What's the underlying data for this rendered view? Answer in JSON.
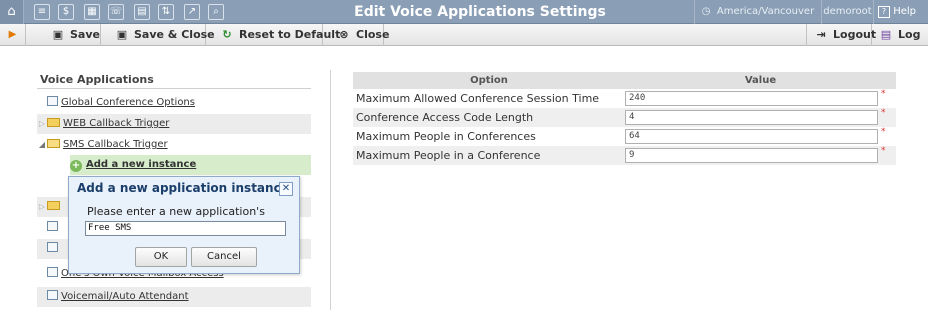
{
  "header": {
    "title": "Edit Voice Applications Settings",
    "timezone": "America/Vancouver",
    "user": "demoroot",
    "help_label": "Help"
  },
  "toolbar": {
    "save_label": "Save",
    "save_close_label": "Save & Close",
    "reset_label": "Reset to Default",
    "close_label": "Close",
    "logout_label": "Logout",
    "log_label": "Log"
  },
  "sidebar": {
    "title": "Voice Applications",
    "items": [
      {
        "label": "Global Conference Options",
        "icon": "document-icon"
      },
      {
        "label": "WEB Callback Trigger",
        "icon": "folder-icon"
      },
      {
        "label": "SMS Callback Trigger",
        "icon": "folder-icon"
      },
      {
        "label": "Add a new instance",
        "icon": "add-icon"
      },
      {
        "label": "One's Own Voice Mailbox Access",
        "icon": "document-icon"
      },
      {
        "label": "Voicemail/Auto Attendant",
        "icon": "document-icon"
      }
    ]
  },
  "table": {
    "col_option": "Option",
    "col_value": "Value",
    "rows": [
      {
        "option": "Maximum Allowed Conference Session Time",
        "value": "240"
      },
      {
        "option": "Conference Access Code Length",
        "value": "4"
      },
      {
        "option": "Maximum People in Conferences",
        "value": "64"
      },
      {
        "option": "Maximum People in a Conference",
        "value": "9"
      }
    ],
    "required_mark": "*"
  },
  "dialog": {
    "title": "Add a new application instance",
    "prompt": "Please enter a new application's name:",
    "input_value": "Free SMS",
    "ok_label": "OK",
    "cancel_label": "Cancel",
    "close_glyph": "✕"
  },
  "colors": {
    "topbar": "#8a9fb6",
    "dialog_bg": "#e9f1fb",
    "add_row_bg": "#d6ecca"
  }
}
